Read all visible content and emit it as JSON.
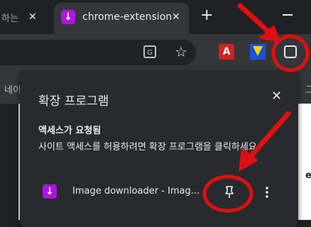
{
  "tabs": {
    "inactive": {
      "title": "하는"
    },
    "active": {
      "title": "chrome-extension",
      "favicon_glyph": "↓"
    }
  },
  "toolbar": {
    "translate_glyph": "G",
    "star_glyph": "☆",
    "pdf_glyph": "A"
  },
  "page": {
    "bookmark_left": "네이",
    "bookmark_right": "그",
    "right_fragment": "e"
  },
  "popup": {
    "title": "확장 프로그램",
    "close_glyph": "✕",
    "access_title": "액세스가 요청됨",
    "access_desc": "사이트 액세스를 허용하려면 확장 프로그램을 클릭하세요.",
    "extension": {
      "name": "Image downloader - Imag...",
      "favicon_glyph": "↓",
      "more_glyph": "⋮"
    }
  },
  "colors": {
    "annotation_red": "#e01010",
    "extension_purple": "#b014e0",
    "popup_bg": "#292a2d"
  }
}
